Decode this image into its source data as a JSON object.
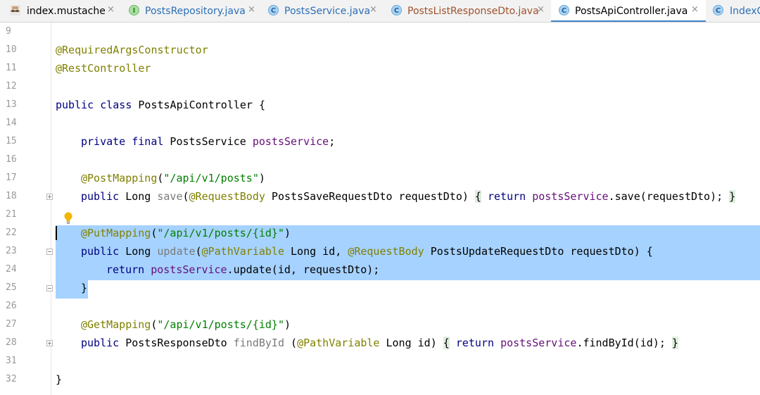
{
  "tabs": [
    {
      "label": "index.mustache",
      "icon": "mustache-icon",
      "color": "#000000"
    },
    {
      "label": "PostsRepository.java",
      "icon": "interface-icon",
      "color": "#2b6fb5"
    },
    {
      "label": "PostsService.java",
      "icon": "class-icon",
      "color": "#2b6fb5"
    },
    {
      "label": "PostsListResponseDto.java",
      "icon": "class-icon",
      "color": "#a0522d"
    },
    {
      "label": "PostsApiController.java",
      "icon": "class-icon",
      "color": "#000000",
      "active": true
    },
    {
      "label": "IndexC",
      "icon": "class-icon",
      "color": "#2b6fb5"
    }
  ],
  "tab_close_glyph": "×",
  "tab_icon_letters": {
    "class": "C",
    "interface": "I"
  },
  "line_numbers": [
    "9",
    "10",
    "11",
    "12",
    "13",
    "14",
    "15",
    "16",
    "17",
    "18",
    "21",
    "22",
    "23",
    "24",
    "25",
    "26",
    "27",
    "28",
    "31",
    "32"
  ],
  "code": {
    "l10": "@RequiredArgsConstructor",
    "l11": "@RestController",
    "l13_kw": "public class",
    "l13_rest": " PostsApiController {",
    "l15_kw": "private final",
    "l15_type": " PostsService ",
    "l15_field": "postsService",
    "l15_end": ";",
    "l17_ann": "@PostMapping",
    "l17_open": "(",
    "l17_str": "\"/api/v1/posts\"",
    "l17_close": ")",
    "l18_kw": "public",
    "l18_type": " Long ",
    "l18_mth": "save",
    "l18_p1": "(",
    "l18_ann": "@RequestBody",
    "l18_p2": " PostsSaveRequestDto requestDto) ",
    "l18_brace_open": "{",
    "l18_sp": " ",
    "l18_kw2": "return",
    "l18_sp2": " ",
    "l18_field": "postsService",
    "l18_call": ".save(requestDto); ",
    "l18_brace_close": "}",
    "l22_ann": "@PutMapping",
    "l22_open": "(",
    "l22_str": "\"/api/v1/posts/{id}\"",
    "l22_close": ")",
    "l23_kw": "public",
    "l23_type": " Long ",
    "l23_mth": "update",
    "l23_p1": "(",
    "l23_ann1": "@PathVariable",
    "l23_p2": " Long id, ",
    "l23_ann2": "@RequestBody",
    "l23_p3": " PostsUpdateRequestDto requestDto) {",
    "l24_kw": "return",
    "l24_sp": " ",
    "l24_field": "postsService",
    "l24_call": ".update(id, requestDto);",
    "l25": "}",
    "l27_ann": "@GetMapping",
    "l27_open": "(",
    "l27_str": "\"/api/v1/posts/{id}\"",
    "l27_close": ")",
    "l28_kw": "public",
    "l28_type": " PostsResponseDto ",
    "l28_mth": "findById",
    "l28_p1": " (",
    "l28_ann": "@PathVariable",
    "l28_p2": " Long id) ",
    "l28_brace_open": "{",
    "l28_sp": " ",
    "l28_kw2": "return",
    "l28_sp2": " ",
    "l28_field": "postsService",
    "l28_call": ".findById(id); ",
    "l28_brace_close": "}",
    "l32": "}"
  },
  "colors": {
    "keyword": "#000080",
    "annotation": "#808000",
    "string": "#008000",
    "field": "#660e7a",
    "selection": "#a6d2ff",
    "active_tab_underline": "#4083c9"
  }
}
